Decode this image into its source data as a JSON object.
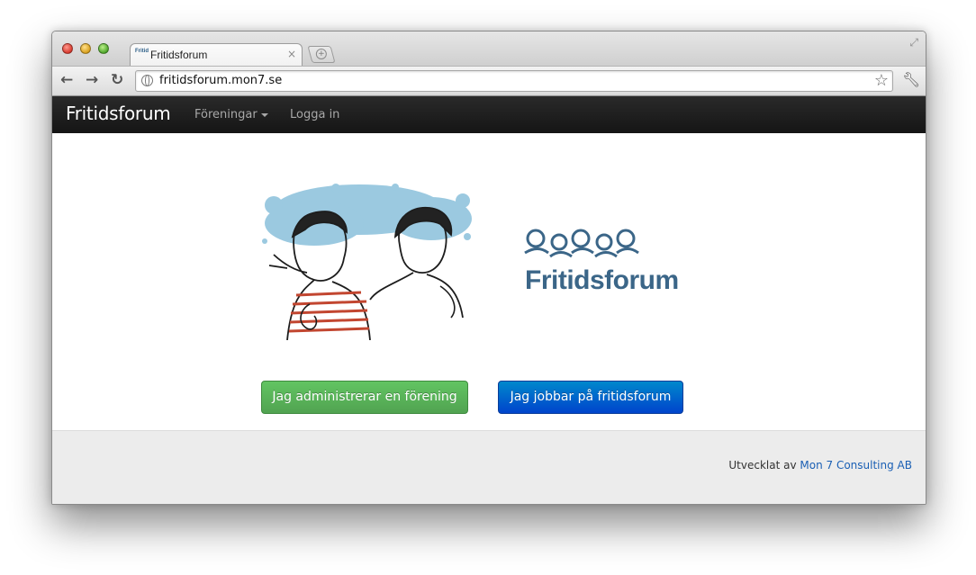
{
  "browser": {
    "tab_title": "Fritidsforum",
    "tab_favicon_text": "Fritid",
    "tab_close": "×",
    "url": "fritidsforum.mon7.se",
    "icons": [
      "back-arrow-icon",
      "forward-arrow-icon",
      "reload-icon",
      "globe-icon",
      "star-icon",
      "wrench-icon",
      "new-tab-icon",
      "fullscreen-icon"
    ]
  },
  "navbar": {
    "brand": "Fritidsforum",
    "links": [
      {
        "label": "Föreningar",
        "dropdown": true
      },
      {
        "label": "Logga in",
        "dropdown": false
      }
    ]
  },
  "main": {
    "logo_text": "Fritidsforum",
    "buttons": [
      {
        "label": "Jag administrerar en förening",
        "color": "#5bb75b"
      },
      {
        "label": "Jag jobbar på fritidsforum",
        "color": "#006dcc"
      }
    ]
  },
  "footer": {
    "prefix": "Utvecklat av",
    "link": "Mon 7 Consulting AB"
  }
}
